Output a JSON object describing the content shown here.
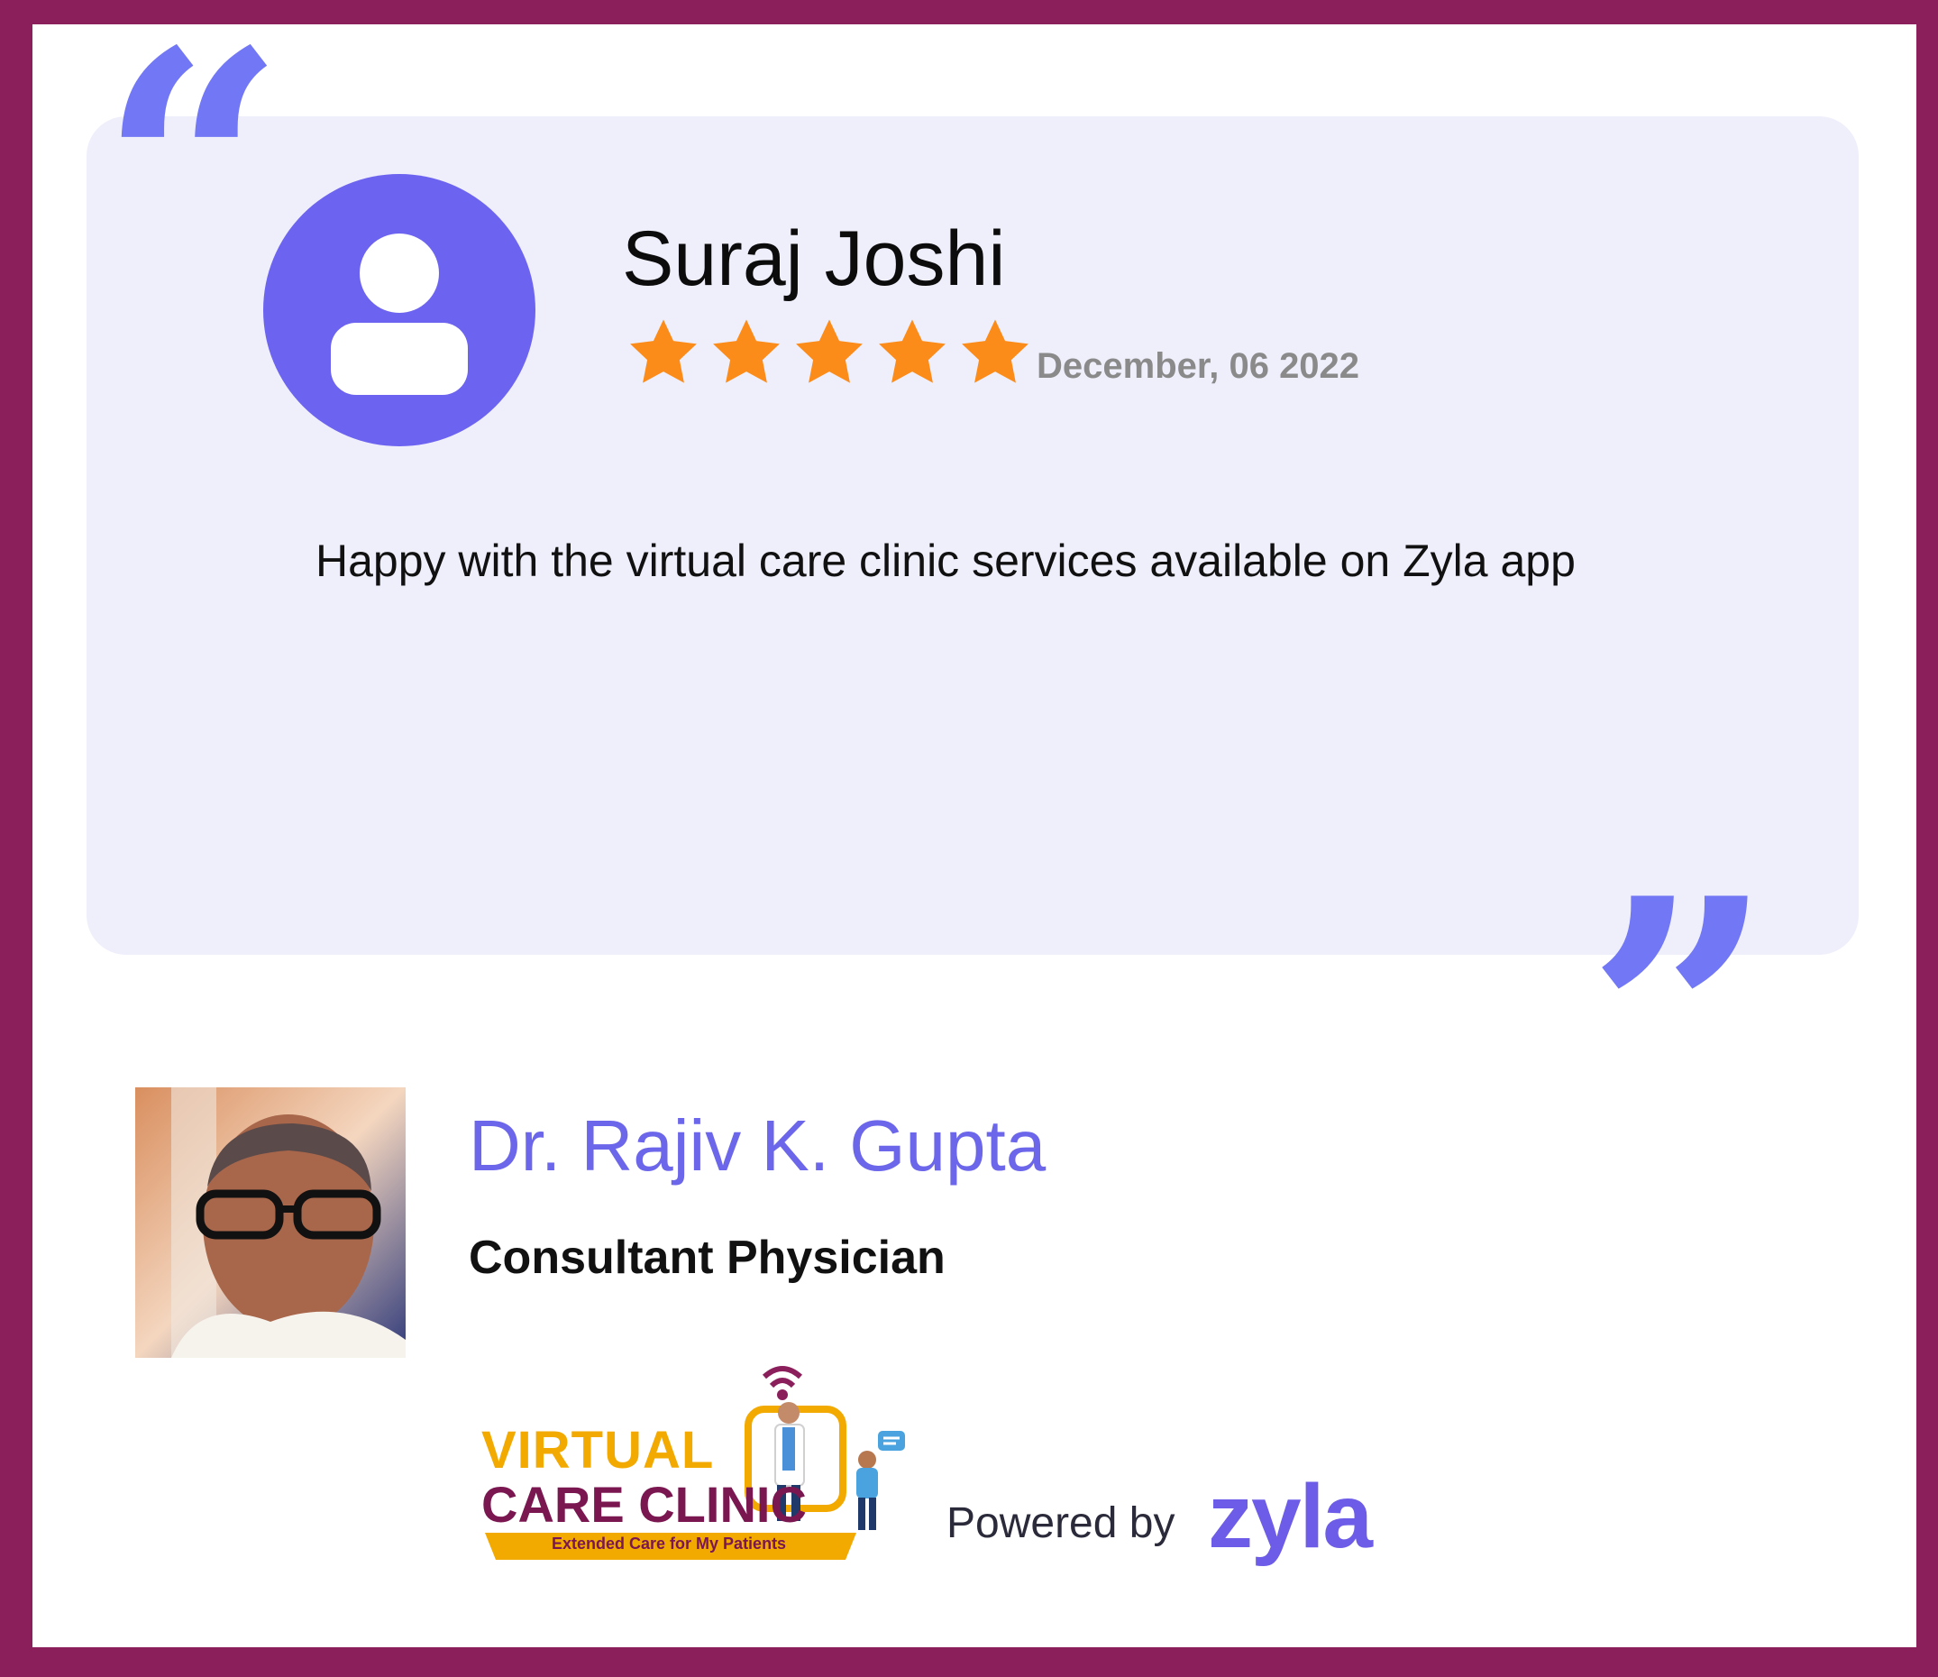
{
  "review": {
    "reviewer_name": "Suraj Joshi",
    "rating": 5,
    "rating_max": 5,
    "date": "December, 06 2022",
    "text": "Happy with the virtual care clinic services available on Zyla app"
  },
  "doctor": {
    "name": "Dr. Rajiv K. Gupta",
    "title": "Consultant Physician"
  },
  "branding": {
    "logo_line1": "VIRTUAL",
    "logo_line2": "CARE CLINIC",
    "logo_tagline": "Extended Care for My Patients",
    "powered_by": "Powered by",
    "zyla": "zyla"
  },
  "icons": {
    "open_quote": "open-quote-icon",
    "close_quote": "close-quote-icon",
    "avatar": "user-avatar-icon",
    "star": "star-icon"
  },
  "colors": {
    "frame": "#8a1f5c",
    "card_bg": "#efeffc",
    "accent": "#6c63f0",
    "star": "#fb8c1a",
    "doctor_name": "#6c66ea",
    "zyla": "#6c5ce7"
  }
}
